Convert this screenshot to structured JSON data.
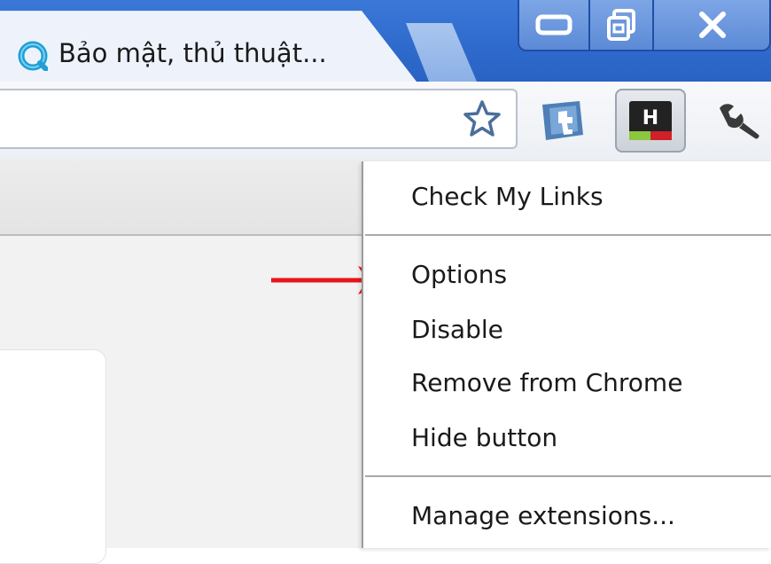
{
  "tab": {
    "title": "Bảo mật, thủ thuật..."
  },
  "window_controls": {
    "minimize_icon": "minimize-icon",
    "restore_icon": "restore-icon",
    "close_label": "X"
  },
  "toolbar": {
    "icons": [
      "star-icon",
      "extension-t-icon",
      "extension-h-icon",
      "wrench-icon"
    ],
    "h_button_letter": "H"
  },
  "context_menu": {
    "title_item": "Check My Links",
    "items": [
      "Options",
      "Disable",
      "Remove from Chrome",
      "Hide button"
    ],
    "footer_item": "Manage extensions..."
  },
  "annotation": {
    "arrow_color": "#e8141c",
    "points_to": "Options"
  },
  "colors": {
    "titlebar": "#2e6acc",
    "tab": "#eef3fb",
    "menu_bg": "#ffffff"
  }
}
